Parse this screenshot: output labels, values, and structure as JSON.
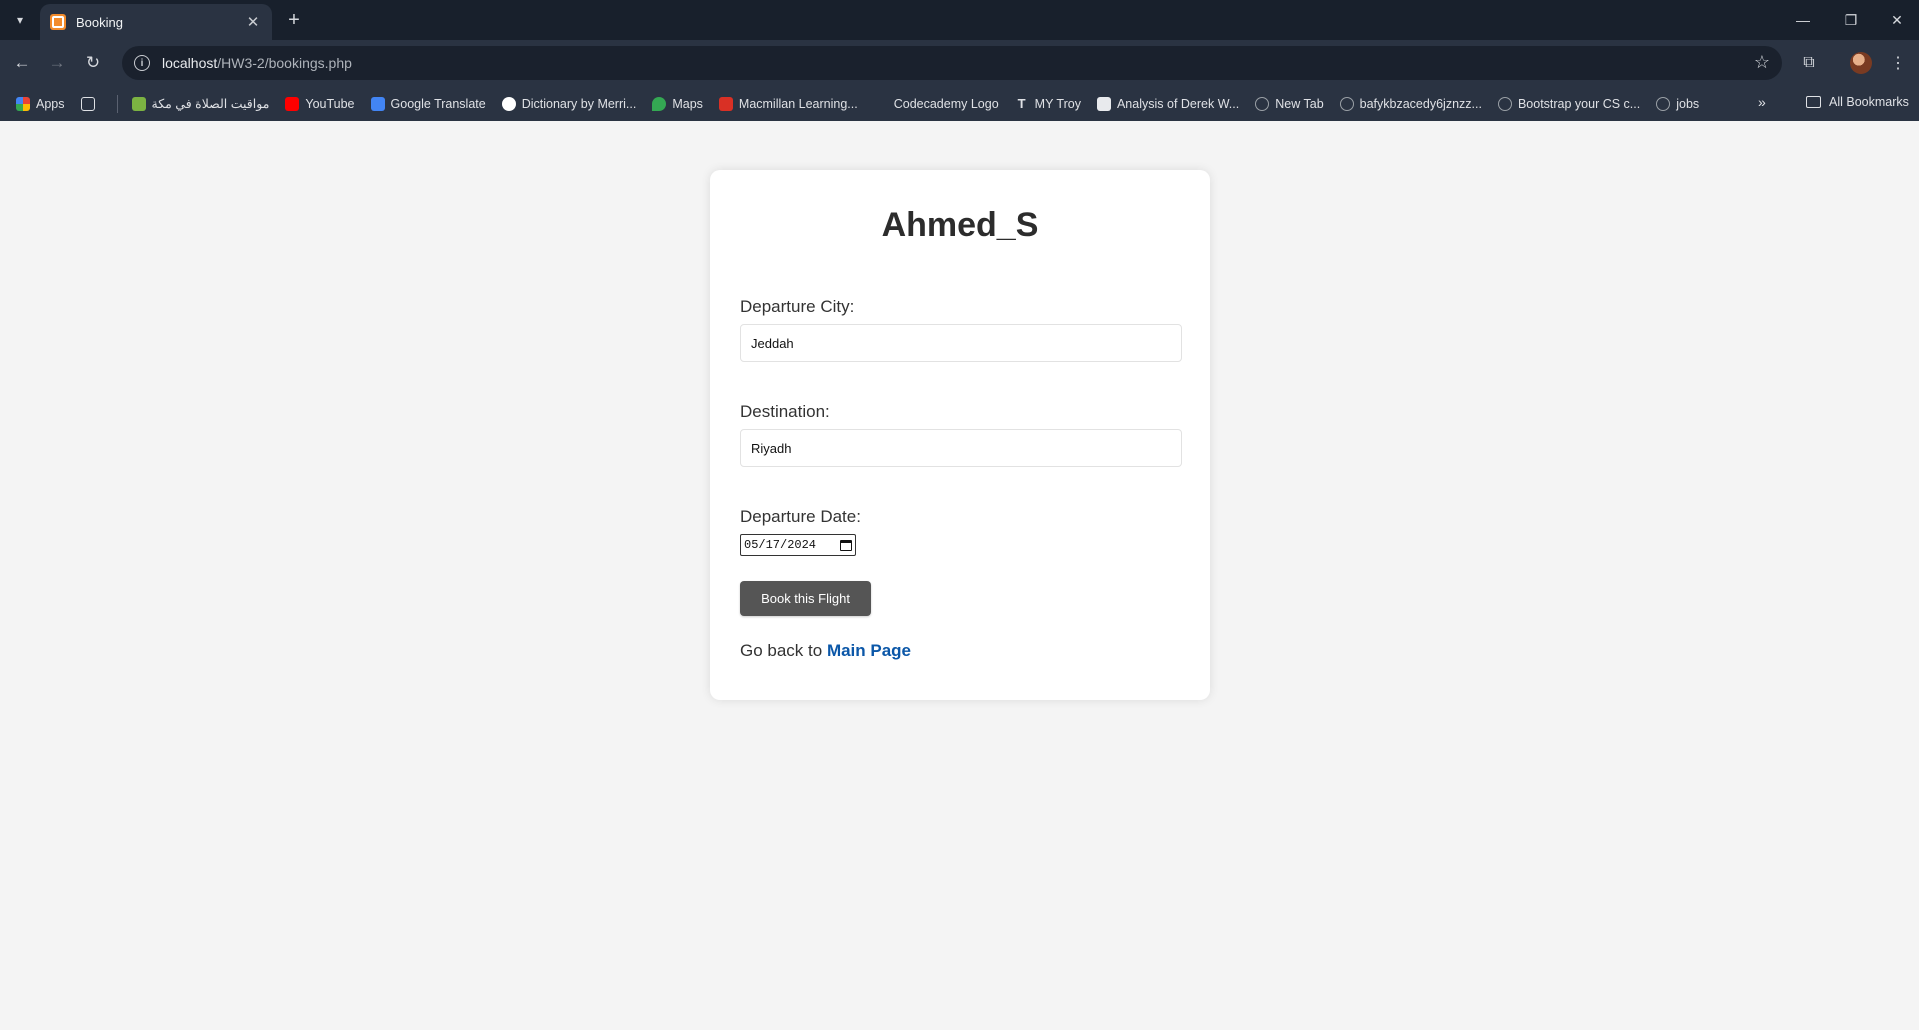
{
  "browser": {
    "tab": {
      "title": "Booking"
    },
    "address": {
      "host": "localhost",
      "path": "/HW3-2/bookings.php"
    },
    "bookmarks": [
      {
        "label": "Apps",
        "color": "#ea4335"
      },
      {
        "label": "مواقيت الصلاة في مكة",
        "color": "#7cb342"
      },
      {
        "label": "YouTube",
        "color": "#ff0000"
      },
      {
        "label": "Google Translate",
        "color": "#4285f4"
      },
      {
        "label": "Dictionary by Merri...",
        "color": "#ffffff"
      },
      {
        "label": "Maps",
        "color": "#34a853"
      },
      {
        "label": "Macmillan Learning...",
        "color": "#d93025"
      },
      {
        "label": "Codecademy Logo",
        "color": "#2a3342"
      },
      {
        "label": "MY Troy",
        "color": "#2a3342"
      },
      {
        "label": "Analysis of Derek W...",
        "color": "#e8eaed"
      },
      {
        "label": "New Tab",
        "color": "#9aa0a6"
      },
      {
        "label": "bafykbzacedy6jznzz...",
        "color": "#9aa0a6"
      },
      {
        "label": "Bootstrap your CS c...",
        "color": "#9aa0a6"
      },
      {
        "label": "jobs",
        "color": "#9aa0a6"
      }
    ],
    "all_bookmarks_label": "All Bookmarks"
  },
  "page": {
    "title": "Ahmed_S",
    "departure_label": "Departure City:",
    "departure_value": "Jeddah",
    "destination_label": "Destination:",
    "destination_value": "Riyadh",
    "date_label": "Departure Date:",
    "date_value": "05/17/2024",
    "book_button": "Book this Flight",
    "goback_text": "Go back to ",
    "goback_link": "Main Page"
  }
}
